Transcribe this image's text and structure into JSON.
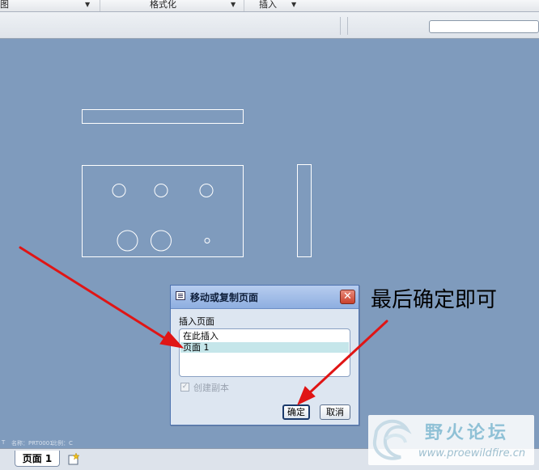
{
  "menubar": {
    "items": [
      {
        "label": "图"
      },
      {
        "label": "格式化"
      },
      {
        "label": "插入"
      }
    ]
  },
  "annotation": "最后确定即可",
  "dialog": {
    "title": "移动或复制页面",
    "close_label": "✕",
    "group_label": "插入页面",
    "list_items": [
      {
        "label": "在此插入",
        "selected": false
      },
      {
        "label": "页面 1",
        "selected": true
      }
    ],
    "checkbox_label": "创建副本",
    "checkbox_checked": true,
    "checkbox_enabled": false,
    "ok_label": "确定",
    "cancel_label": "取消"
  },
  "status": {
    "left": "T",
    "name": "名称：PRT0001",
    "ratio": "比例：C"
  },
  "tabs": [
    {
      "label": "页面 1",
      "active": true
    }
  ],
  "watermark": {
    "name": "野火论坛",
    "url": "www.proewildfire.cn"
  },
  "colors": {
    "canvas": "#7f9bbd",
    "drawing_lines": "#ffffff",
    "arrow": "#e01515",
    "list_selection": "#c5e6ea"
  },
  "icons": [
    "dialog-window-icon",
    "close-icon",
    "checkbox-icon",
    "new-page-icon",
    "watermark-logo-icon"
  ]
}
